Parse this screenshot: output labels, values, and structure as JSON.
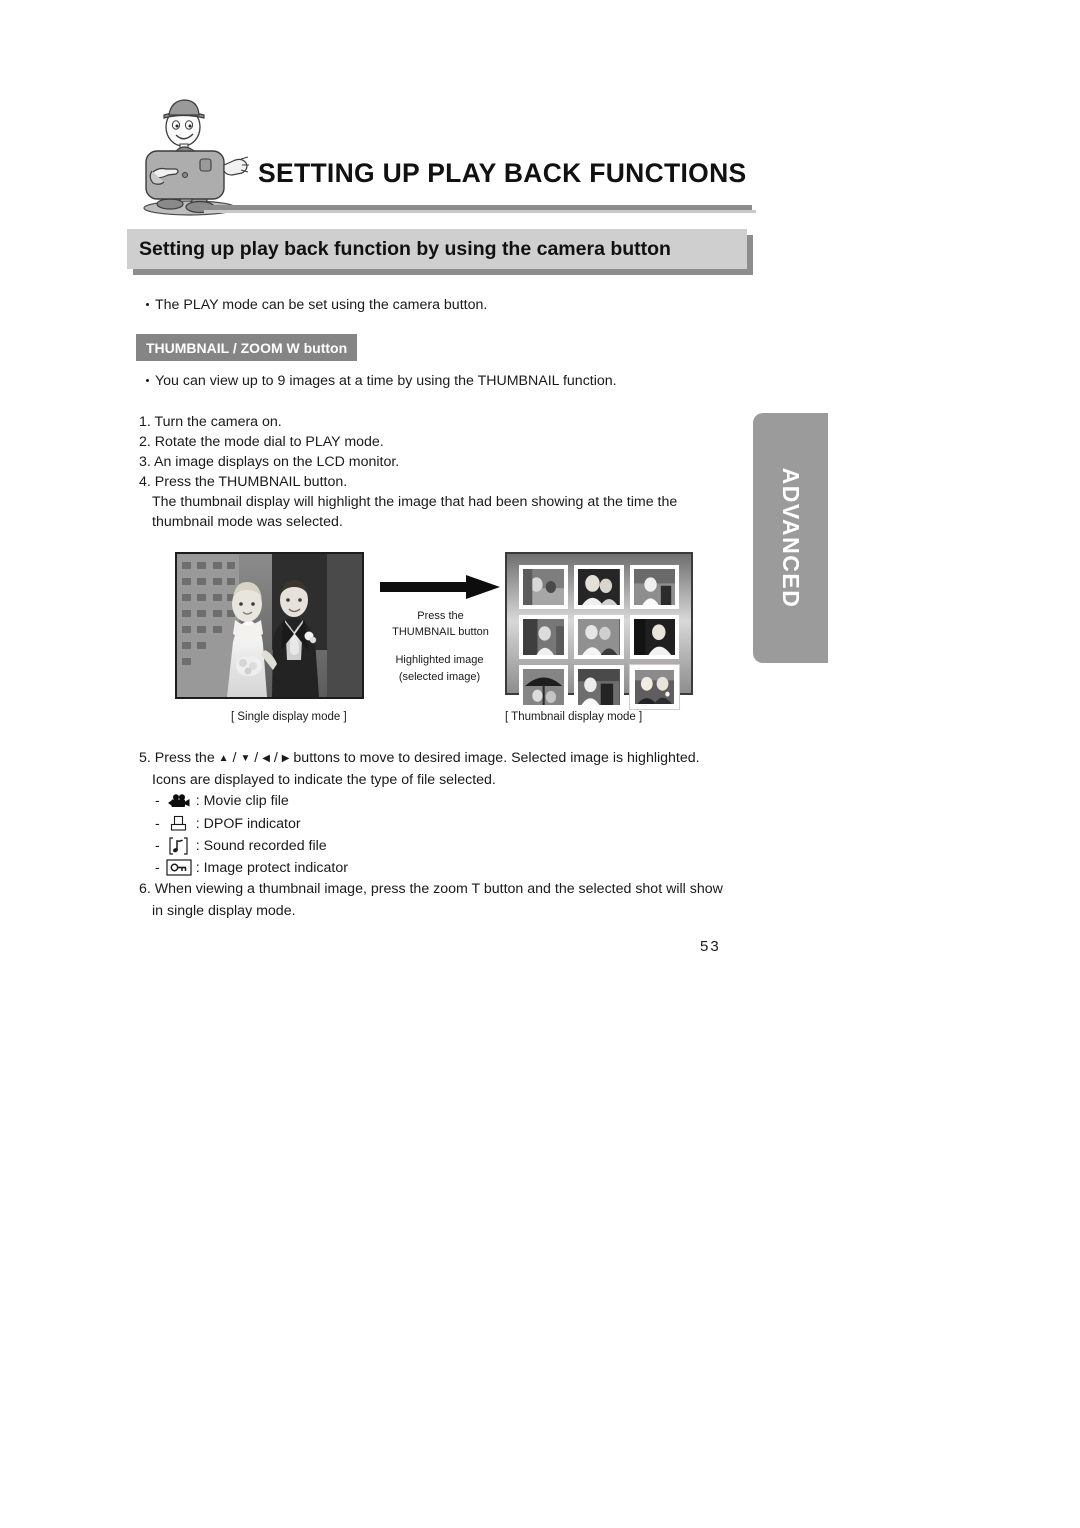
{
  "document": {
    "chapter_title": "SETTING UP PLAY BACK FUNCTIONS",
    "section_title": "Setting up play back function by using the camera button",
    "page_number": "53",
    "side_tab_label": "ADVANCED"
  },
  "intro": {
    "bullet": "The PLAY mode can be set using the camera button."
  },
  "badge": {
    "label": "THUMBNAIL / ZOOM W button"
  },
  "thumbnail_section": {
    "bullet": "You can view up to 9  images at a time by using the THUMBNAIL function.",
    "steps": [
      "1. Turn the camera on.",
      "2. Rotate the mode dial to PLAY mode.",
      "3. An image displays on the LCD monitor.",
      "4. Press the THUMBNAIL button."
    ],
    "step4_continuation_1": "The thumbnail display will highlight the  image that had been showing at the time the",
    "step4_continuation_2": "thumbnail mode was selected."
  },
  "figure": {
    "arrow_label_line1": "Press the",
    "arrow_label_line2": "THUMBNAIL button",
    "highlight_label_line1": "Highlighted  image",
    "highlight_label_line2": "(selected  image)",
    "caption_left": "[ Single display mode ]",
    "caption_right": "[ Thumbnail display mode ]"
  },
  "step5": {
    "prefix": "5. Press the",
    "sep": "/",
    "suffix": "buttons to move to desired image. Selected image is highlighted.",
    "line2": "Icons are displayed to indicate the type of file selected.",
    "icons": [
      {
        "icon": "movie-camera-icon",
        "label": ": Movie clip file"
      },
      {
        "icon": "dpof-printer-icon",
        "label": ": DPOF indicator"
      },
      {
        "icon": "sound-note-icon",
        "label": ": Sound recorded file"
      },
      {
        "icon": "key-protect-icon",
        "label": ": Image protect indicator"
      }
    ]
  },
  "step6": {
    "line1": "6. When viewing a thumbnail image, press the zoom T button and the selected shot will show",
    "line2": "in single display mode."
  },
  "colors": {
    "section_bar": "#cfcfcf",
    "section_bar_shadow": "#8d8d8d",
    "badge_bg": "#858585",
    "side_tab": "#9b9b9b",
    "rule": "#8d8d8d"
  }
}
